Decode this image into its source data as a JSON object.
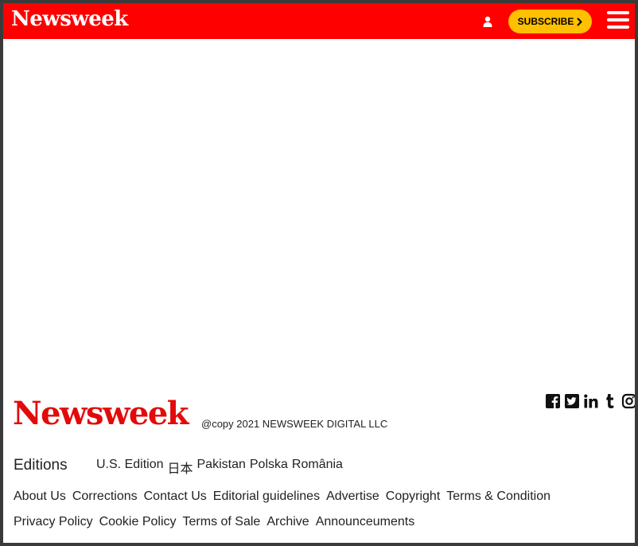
{
  "header": {
    "logo": "Newsweek",
    "subscribe_label": "SUBSCRIBE",
    "icons": [
      "user-icon",
      "chevron-right-icon",
      "menu-icon"
    ]
  },
  "footer": {
    "logo": "Newsweek",
    "copyright": "@copy 2021 NEWSWEEK DIGITAL LLC",
    "social_icons": [
      "facebook-icon",
      "twitter-icon",
      "linkedin-icon",
      "tumblr-icon",
      "instagram-icon"
    ],
    "editions_label": "Editions",
    "editions": [
      "U.S. Edition",
      "日本",
      "Pakistan",
      "Polska",
      "România"
    ],
    "links_row1": [
      "About Us",
      "Corrections",
      "Contact Us",
      "Editorial guidelines",
      "Advertise",
      "Copyright",
      "Terms & Condition"
    ],
    "links_row2": [
      "Privacy Policy",
      "Cookie Policy",
      "Terms of Sale",
      "Archive",
      "Announceuments"
    ]
  },
  "colors": {
    "header_bg": "#ff0000",
    "subscribe_bg": "#ffc000",
    "footer_logo": "#e30a0a"
  }
}
